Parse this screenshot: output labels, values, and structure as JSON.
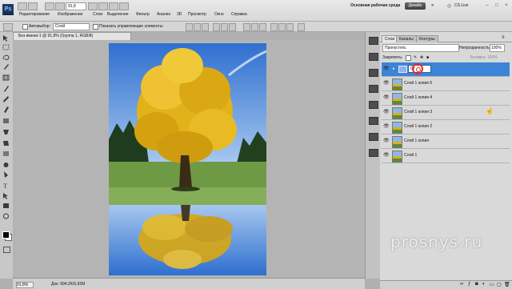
{
  "menubar": {
    "logo": "Ps",
    "items": [
      "Файл",
      "Редактирование",
      "Изображение",
      "Слои",
      "Выделение",
      "Фильтр",
      "Анализ",
      "3D",
      "Просмотр",
      "Окно",
      "Справка"
    ],
    "zoom": "91,8",
    "workspace": "Основная рабочая среда",
    "design": "Дизайн",
    "cslive": "CS Live"
  },
  "options": {
    "autoselect_label": "Автовыбор:",
    "autoselect_value": "Слой",
    "show_controls_label": "Показать управляющие элементы"
  },
  "document": {
    "tab_title": "Без имени-1 @ 91,8% (Группа 1, RGB/8)",
    "status_zoom": "91,8%",
    "status_doc": "Док: 994,2K/6,92M"
  },
  "layers_panel": {
    "tabs": [
      "Слои",
      "Каналы",
      "Контуры"
    ],
    "blend_mode": "Пропустить",
    "opacity_label": "Непрозрачность:",
    "opacity_value": "100%",
    "lock_label": "Закрепить:",
    "fill_label": "Заливка: 100%",
    "rename_text": "Gr",
    "layers": [
      {
        "name": "Слой 1 копия 5"
      },
      {
        "name": "Слой 1 копия 4"
      },
      {
        "name": "Слой 1 копия 3"
      },
      {
        "name": "Слой 1 копия 2"
      },
      {
        "name": "Слой 1 копия"
      },
      {
        "name": "Слой 1"
      }
    ]
  },
  "watermark": "prosnys.ru",
  "colors": {
    "selection": "#3d84d6",
    "sky": "#4a86d8",
    "foliage": "#e2b21a",
    "grass": "#6f9a45"
  }
}
